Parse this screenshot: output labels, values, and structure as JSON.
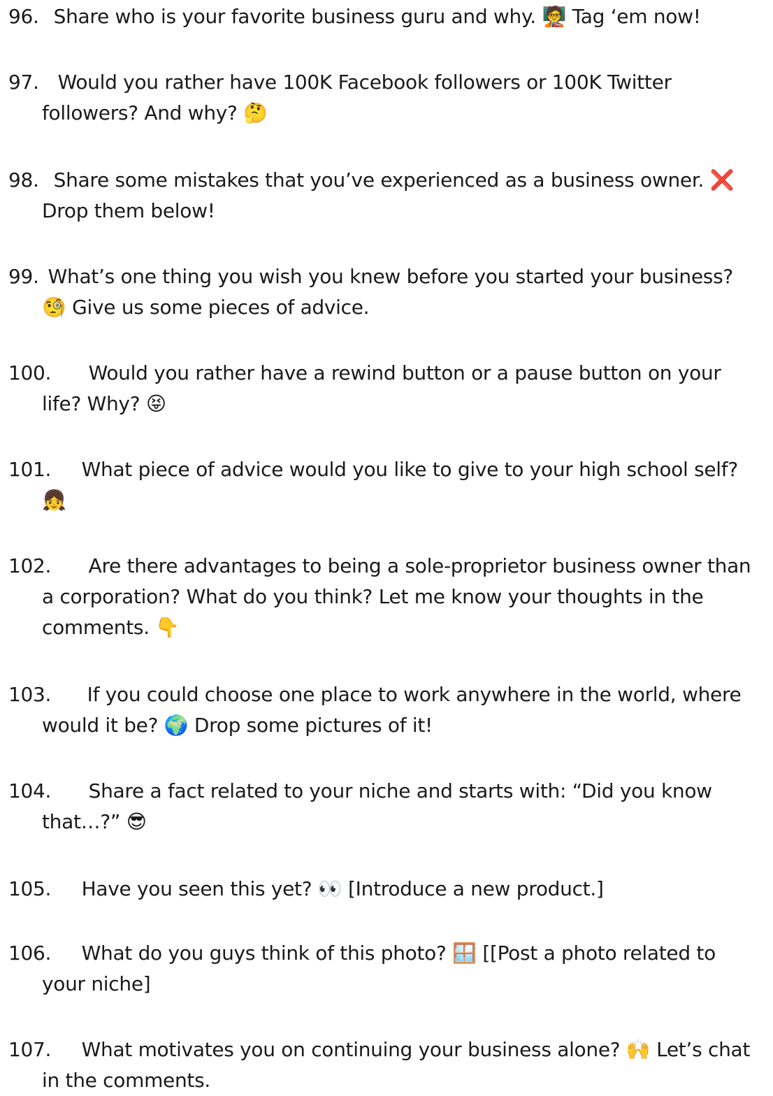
{
  "items": [
    {
      "number": "96.",
      "lines": [
        "Share who is your favorite business guru and why. 🧑‍🏫 Tag ‘em now!"
      ]
    },
    {
      "number": "97.",
      "lines": [
        "Would you rather have 100K Facebook followers or 100K Twitter",
        "followers? And why? 🤔"
      ]
    },
    {
      "number": "98.",
      "lines": [
        "Share some mistakes that you’ve experienced as a business owner. ❌",
        "Drop them below!"
      ]
    },
    {
      "number": "99.",
      "lines": [
        "What’s one thing you wish you knew before you started your business?",
        "🧐 Give us some pieces of advice."
      ]
    },
    {
      "number": "100.",
      "lines": [
        "Would you rather have a rewind button or a pause button on your",
        "life? Why? 😝"
      ]
    },
    {
      "number": "101.",
      "lines": [
        "What piece of advice would you like to give to your high school self?",
        "👧"
      ]
    },
    {
      "number": "102.",
      "lines": [
        "Are there advantages to being a sole-proprietor business owner than",
        "a corporation? What do you think? Let me know your thoughts in the",
        "comments. 👇"
      ]
    },
    {
      "number": "103.",
      "lines": [
        "If you could choose one place to work anywhere in the world, where",
        "would it be? 🌍 Drop some pictures of it!"
      ]
    },
    {
      "number": "104.",
      "lines": [
        "Share a fact related to your niche and starts with: “Did you know",
        "that…?”  😎"
      ]
    },
    {
      "number": "105.",
      "lines": [
        "Have you seen this yet? 👀 [Introduce a new product.]"
      ]
    },
    {
      "number": "106.",
      "lines": [
        "What do you guys think of this photo? 🪟 [[Post a photo related to",
        "your niche]"
      ]
    },
    {
      "number": "107.",
      "lines": [
        "What motivates you on continuing your business alone? 🙌 Let’s chat",
        "in the comments."
      ]
    }
  ]
}
